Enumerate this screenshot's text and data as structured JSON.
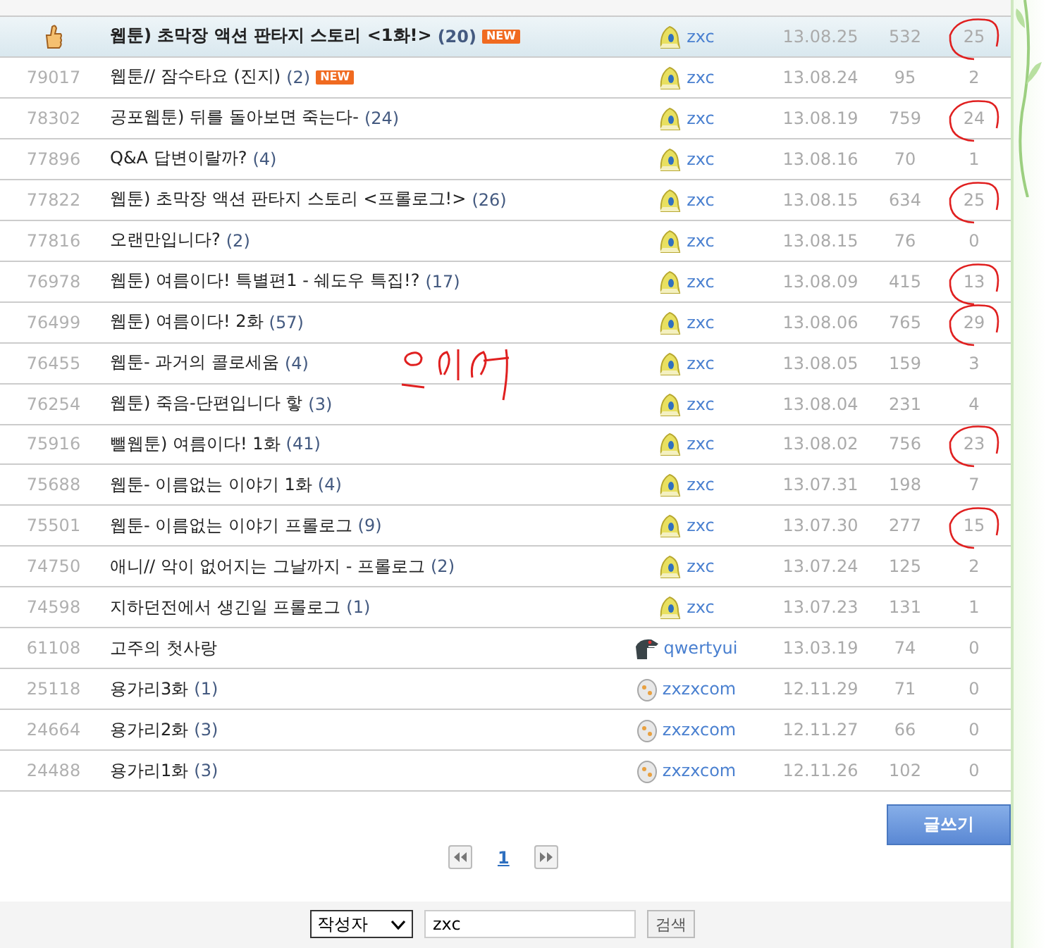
{
  "posts": [
    {
      "kind": "best",
      "title": "웹툰) 초막장 액션 판타지 스토리 <1화!>",
      "replies": "(20)",
      "badge": "NEW",
      "author": {
        "kind": "ghost",
        "name": "zxc"
      },
      "date": "13.08.25",
      "views": "532",
      "comments": "25",
      "circled": true
    },
    {
      "kind": "normal",
      "number": "79017",
      "title": "웹툰// 잠수타요 (진지)",
      "replies": "(2)",
      "badge": "NEW",
      "author": {
        "kind": "ghost",
        "name": "zxc"
      },
      "date": "13.08.24",
      "views": "95",
      "comments": "2",
      "circled": false
    },
    {
      "kind": "normal",
      "number": "78302",
      "title": "공포웹툰) 뒤를 돌아보면 죽는다-",
      "replies": "(24)",
      "author": {
        "kind": "ghost",
        "name": "zxc"
      },
      "date": "13.08.19",
      "views": "759",
      "comments": "24",
      "circled": true
    },
    {
      "kind": "normal",
      "number": "77896",
      "title": "Q&A 답변이랄까?",
      "replies": "(4)",
      "author": {
        "kind": "ghost",
        "name": "zxc"
      },
      "date": "13.08.16",
      "views": "70",
      "comments": "1",
      "circled": false
    },
    {
      "kind": "normal",
      "number": "77822",
      "title": "웹툰) 초막장 액션 판타지 스토리 <프롤로그!>",
      "replies": "(26)",
      "author": {
        "kind": "ghost",
        "name": "zxc"
      },
      "date": "13.08.15",
      "views": "634",
      "comments": "25",
      "circled": true
    },
    {
      "kind": "normal",
      "number": "77816",
      "title": "오랜만입니다?",
      "replies": "(2)",
      "author": {
        "kind": "ghost",
        "name": "zxc"
      },
      "date": "13.08.15",
      "views": "76",
      "comments": "0",
      "circled": false
    },
    {
      "kind": "normal",
      "number": "76978",
      "title": "웹툰) 여름이다! 특별편1 - 쉐도우 특집!?",
      "replies": "(17)",
      "author": {
        "kind": "ghost",
        "name": "zxc"
      },
      "date": "13.08.09",
      "views": "415",
      "comments": "13",
      "circled": true
    },
    {
      "kind": "normal",
      "number": "76499",
      "title": "웹툰) 여름이다! 2화",
      "replies": "(57)",
      "author": {
        "kind": "ghost",
        "name": "zxc"
      },
      "date": "13.08.06",
      "views": "765",
      "comments": "29",
      "circled": true
    },
    {
      "kind": "normal",
      "number": "76455",
      "title": "웹툰- 과거의 콜로세움",
      "replies": "(4)",
      "author": {
        "kind": "ghost",
        "name": "zxc"
      },
      "date": "13.08.05",
      "views": "159",
      "comments": "3",
      "circled": false
    },
    {
      "kind": "normal",
      "number": "76254",
      "title": "웹툰) 죽음-단편입니다 핳",
      "replies": "(3)",
      "author": {
        "kind": "ghost",
        "name": "zxc"
      },
      "date": "13.08.04",
      "views": "231",
      "comments": "4",
      "circled": false
    },
    {
      "kind": "normal",
      "number": "75916",
      "title": "뺄웹툰) 여름이다! 1화",
      "replies": "(41)",
      "author": {
        "kind": "ghost",
        "name": "zxc"
      },
      "date": "13.08.02",
      "views": "756",
      "comments": "23",
      "circled": true
    },
    {
      "kind": "normal",
      "number": "75688",
      "title": "웹툰- 이름없는 이야기 1화",
      "replies": "(4)",
      "author": {
        "kind": "ghost",
        "name": "zxc"
      },
      "date": "13.07.31",
      "views": "198",
      "comments": "7",
      "circled": false
    },
    {
      "kind": "normal",
      "number": "75501",
      "title": "웹툰- 이름없는 이야기 프롤로그",
      "replies": "(9)",
      "author": {
        "kind": "ghost",
        "name": "zxc"
      },
      "date": "13.07.30",
      "views": "277",
      "comments": "15",
      "circled": true
    },
    {
      "kind": "normal",
      "number": "74750",
      "title": "애니// 악이 없어지는 그날까지 - 프롤로그",
      "replies": "(2)",
      "author": {
        "kind": "ghost",
        "name": "zxc"
      },
      "date": "13.07.24",
      "views": "125",
      "comments": "2",
      "circled": false
    },
    {
      "kind": "normal",
      "number": "74598",
      "title": "지하던전에서 생긴일 프롤로그",
      "replies": "(1)",
      "author": {
        "kind": "ghost",
        "name": "zxc"
      },
      "date": "13.07.23",
      "views": "131",
      "comments": "1",
      "circled": false
    },
    {
      "kind": "normal",
      "number": "61108",
      "title": "고주의 첫사랑",
      "author": {
        "kind": "dino",
        "name": "qwertyui"
      },
      "date": "13.03.19",
      "views": "74",
      "comments": "0",
      "circled": false
    },
    {
      "kind": "normal",
      "number": "25118",
      "title": "용가리3화",
      "replies": "(1)",
      "author": {
        "kind": "egg",
        "name": "zxzxcom"
      },
      "date": "12.11.29",
      "views": "71",
      "comments": "0",
      "circled": false
    },
    {
      "kind": "normal",
      "number": "24664",
      "title": "용가리2화",
      "replies": "(3)",
      "author": {
        "kind": "egg",
        "name": "zxzxcom"
      },
      "date": "12.11.27",
      "views": "66",
      "comments": "0",
      "circled": false
    },
    {
      "kind": "normal",
      "number": "24488",
      "title": "용가리1화",
      "replies": "(3)",
      "author": {
        "kind": "egg",
        "name": "zxzxcom"
      },
      "date": "12.11.26",
      "views": "102",
      "comments": "0",
      "circled": false
    }
  ],
  "write_button": "글쓰기",
  "pagination": {
    "pages": [
      "1"
    ]
  },
  "search": {
    "field": "작성자",
    "value": "zxc",
    "button": "검색"
  }
}
